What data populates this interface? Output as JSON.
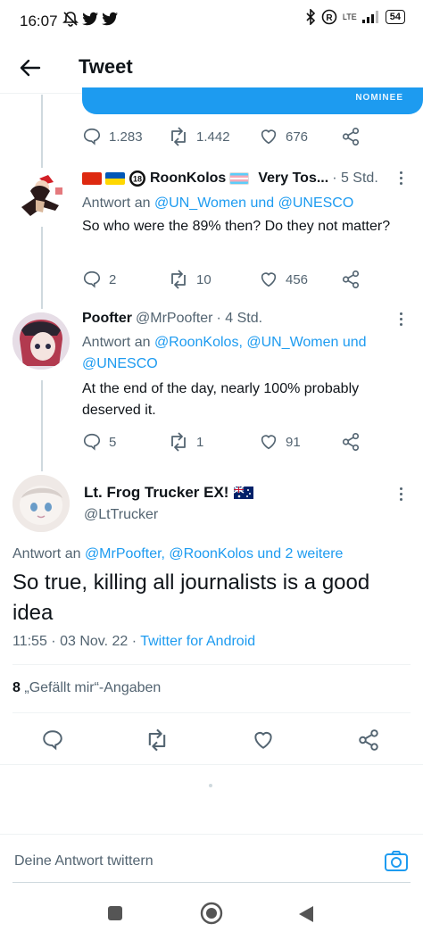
{
  "status_bar": {
    "time": "16:07",
    "network": "LTE",
    "battery": "54"
  },
  "header": {
    "title": "Tweet"
  },
  "quoted_card": {
    "label": "NOMINEE"
  },
  "parent_actions": {
    "replies": "1.283",
    "retweets": "1.442",
    "likes": "676"
  },
  "tweets": [
    {
      "name": "RoonKolos",
      "name_suffix": "Very Tos...",
      "time": "· 5 Std.",
      "reply_to_prefix": "Antwort an",
      "reply_to": "@UN_Women und @UNESCO",
      "text": "So who were the 89% then? Do they not matter?",
      "replies": "2",
      "retweets": "10",
      "likes": "456"
    },
    {
      "name": "Poofter",
      "handle": "@MrPoofter",
      "time": "· 4 Std.",
      "reply_to_prefix": "Antwort an",
      "reply_to": "@RoonKolos, @UN_Women und @UNESCO",
      "text": "At the end of the day, nearly 100% probably deserved it.",
      "replies": "5",
      "retweets": "1",
      "likes": "91"
    }
  ],
  "main_tweet": {
    "name": "Lt. Frog Trucker EX!",
    "handle": "@LtTrucker",
    "reply_to_prefix": "Antwort an",
    "reply_to": "@MrPoofter, @RoonKolos und 2 weitere",
    "text": "So true, killing all journalists is a good idea",
    "time": "11:55 · 03 Nov. 22 · ",
    "source": "Twitter for Android",
    "likes_count": "8",
    "likes_label": "„Gefällt mir“-Angaben"
  },
  "reply_box": {
    "placeholder": "Deine Antwort twittern"
  },
  "colors": {
    "accent": "#1d9bf0",
    "secondary_text": "#536471",
    "primary_text": "#0f1419"
  }
}
